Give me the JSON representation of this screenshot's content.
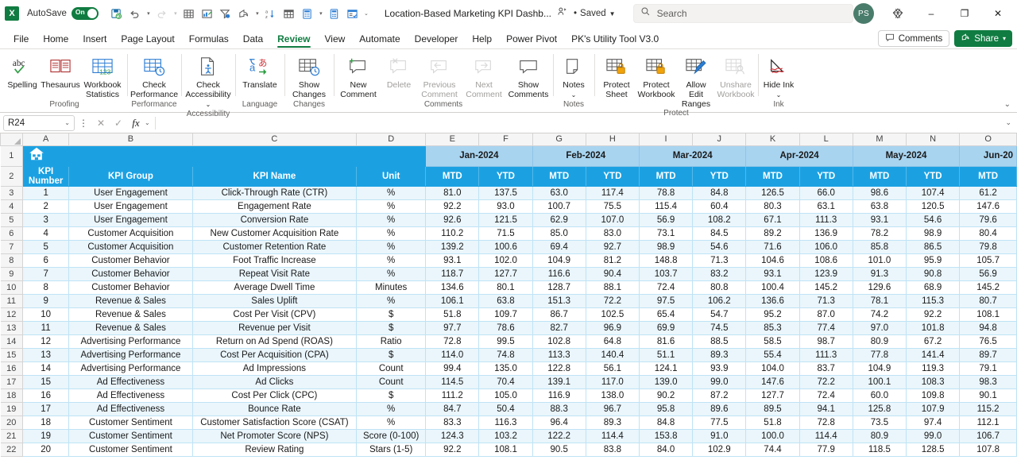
{
  "titlebar": {
    "app_logo": "X",
    "autosave_label": "AutoSave",
    "autosave_state": "On",
    "document_title": "Location-Based Marketing KPI Dashb...",
    "saved_status": "Saved",
    "saved_separator": "•",
    "search_placeholder": "Search",
    "avatar_initials": "PS",
    "minimize": "‒",
    "restore": "❐",
    "close": "✕"
  },
  "quick_access": [
    {
      "name": "save-icon",
      "glyph": "save"
    },
    {
      "name": "undo-icon",
      "glyph": "undo"
    },
    {
      "name": "redo-icon",
      "glyph": "redo"
    },
    {
      "name": "table-icon",
      "glyph": "table"
    },
    {
      "name": "insert-chart-icon",
      "glyph": "chart"
    },
    {
      "name": "filter-icon",
      "glyph": "filter"
    },
    {
      "name": "share-arrow-icon",
      "glyph": "share"
    },
    {
      "name": "sort-az-icon",
      "glyph": "sortaz"
    },
    {
      "name": "pivot-table-icon",
      "glyph": "pivot"
    },
    {
      "name": "calculator-icon",
      "glyph": "calc"
    },
    {
      "name": "calculator2-icon",
      "glyph": "calc2"
    },
    {
      "name": "form-icon",
      "glyph": "form"
    },
    {
      "name": "customize-qat-icon",
      "glyph": "chevron"
    }
  ],
  "ribbon_tabs": [
    {
      "label": "File",
      "active": false
    },
    {
      "label": "Home",
      "active": false
    },
    {
      "label": "Insert",
      "active": false
    },
    {
      "label": "Page Layout",
      "active": false
    },
    {
      "label": "Formulas",
      "active": false
    },
    {
      "label": "Data",
      "active": false
    },
    {
      "label": "Review",
      "active": true
    },
    {
      "label": "View",
      "active": false
    },
    {
      "label": "Automate",
      "active": false
    },
    {
      "label": "Developer",
      "active": false
    },
    {
      "label": "Help",
      "active": false
    },
    {
      "label": "Power Pivot",
      "active": false
    },
    {
      "label": "PK's Utility Tool V3.0",
      "active": false
    }
  ],
  "tabs_right": {
    "comments_label": "Comments",
    "share_label": "Share"
  },
  "ribbon_groups": [
    {
      "name": "Proofing",
      "buttons": [
        {
          "label": "Spelling",
          "icon": "spelling-icon",
          "disabled": false,
          "caret": false
        },
        {
          "label": "Thesaurus",
          "icon": "thesaurus-icon",
          "disabled": false,
          "caret": false
        },
        {
          "label": "Workbook Statistics",
          "icon": "workbook-statistics-icon",
          "disabled": false,
          "caret": false
        }
      ]
    },
    {
      "name": "Performance",
      "buttons": [
        {
          "label": "Check Performance",
          "icon": "check-performance-icon",
          "disabled": false,
          "caret": false
        }
      ]
    },
    {
      "name": "Accessibility",
      "buttons": [
        {
          "label": "Check Accessibility",
          "icon": "check-accessibility-icon",
          "disabled": false,
          "caret": true
        }
      ]
    },
    {
      "name": "Language",
      "buttons": [
        {
          "label": "Translate",
          "icon": "translate-icon",
          "disabled": false,
          "caret": false
        }
      ]
    },
    {
      "name": "Changes",
      "buttons": [
        {
          "label": "Show Changes",
          "icon": "show-changes-icon",
          "disabled": false,
          "caret": false
        }
      ]
    },
    {
      "name": "Comments",
      "buttons": [
        {
          "label": "New Comment",
          "icon": "new-comment-icon",
          "disabled": false,
          "caret": false
        },
        {
          "label": "Delete",
          "icon": "delete-comment-icon",
          "disabled": true,
          "caret": false
        },
        {
          "label": "Previous Comment",
          "icon": "previous-comment-icon",
          "disabled": true,
          "caret": false
        },
        {
          "label": "Next Comment",
          "icon": "next-comment-icon",
          "disabled": true,
          "caret": false
        },
        {
          "label": "Show Comments",
          "icon": "show-comments-icon",
          "disabled": false,
          "caret": false
        }
      ]
    },
    {
      "name": "Notes",
      "buttons": [
        {
          "label": "Notes",
          "icon": "notes-icon",
          "disabled": false,
          "caret": true
        }
      ]
    },
    {
      "name": "Protect",
      "buttons": [
        {
          "label": "Protect Sheet",
          "icon": "protect-sheet-icon",
          "disabled": false,
          "caret": false
        },
        {
          "label": "Protect Workbook",
          "icon": "protect-workbook-icon",
          "disabled": false,
          "caret": false
        },
        {
          "label": "Allow Edit Ranges",
          "icon": "allow-edit-ranges-icon",
          "disabled": false,
          "caret": false
        },
        {
          "label": "Unshare Workbook",
          "icon": "unshare-workbook-icon",
          "disabled": true,
          "caret": false
        }
      ]
    },
    {
      "name": "Ink",
      "buttons": [
        {
          "label": "Hide Ink",
          "icon": "hide-ink-icon",
          "disabled": false,
          "caret": true
        }
      ]
    }
  ],
  "formula_bar": {
    "name_box_value": "R24",
    "cancel_icon": "✕",
    "enter_icon": "✓",
    "fx_label": "fx",
    "formula_value": "",
    "formula_placeholder": ""
  },
  "grid": {
    "column_letters": [
      "A",
      "B",
      "C",
      "D",
      "E",
      "F",
      "G",
      "H",
      "I",
      "J",
      "K",
      "L",
      "M",
      "N",
      "O"
    ],
    "row_numbers": [
      1,
      2,
      3,
      4,
      5,
      6,
      7,
      8,
      9,
      10,
      11,
      12,
      13,
      14,
      15,
      16,
      17,
      18,
      19,
      20,
      21,
      22
    ],
    "home_icon": "home-icon",
    "month_headers": [
      "Jan-2024",
      "Feb-2024",
      "Mar-2024",
      "Apr-2024",
      "May-2024",
      "Jun-20"
    ],
    "sub_headers": [
      "MTD",
      "YTD"
    ],
    "left_headers": [
      "KPI Number",
      "KPI Group",
      "KPI Name",
      "Unit"
    ],
    "header_fill": "#1ba1e2",
    "month_fill": "#a8d4f0",
    "band_fill": "#eaf6fc",
    "rows": [
      {
        "num": "1",
        "group": "User Engagement",
        "kpi": "Click-Through Rate (CTR)",
        "unit": "%",
        "vals": [
          "81.0",
          "137.5",
          "63.0",
          "117.4",
          "78.8",
          "84.8",
          "126.5",
          "66.0",
          "98.6",
          "107.4",
          "61.2"
        ]
      },
      {
        "num": "2",
        "group": "User Engagement",
        "kpi": "Engagement Rate",
        "unit": "%",
        "vals": [
          "92.2",
          "93.0",
          "100.7",
          "75.5",
          "115.4",
          "60.4",
          "80.3",
          "63.1",
          "63.8",
          "120.5",
          "147.6"
        ]
      },
      {
        "num": "3",
        "group": "User Engagement",
        "kpi": "Conversion Rate",
        "unit": "%",
        "vals": [
          "92.6",
          "121.5",
          "62.9",
          "107.0",
          "56.9",
          "108.2",
          "67.1",
          "111.3",
          "93.1",
          "54.6",
          "79.6"
        ]
      },
      {
        "num": "4",
        "group": "Customer Acquisition",
        "kpi": "New Customer Acquisition Rate",
        "unit": "%",
        "vals": [
          "110.2",
          "71.5",
          "85.0",
          "83.0",
          "73.1",
          "84.5",
          "89.2",
          "136.9",
          "78.2",
          "98.9",
          "80.4"
        ]
      },
      {
        "num": "5",
        "group": "Customer Acquisition",
        "kpi": "Customer Retention Rate",
        "unit": "%",
        "vals": [
          "139.2",
          "100.6",
          "69.4",
          "92.7",
          "98.9",
          "54.6",
          "71.6",
          "106.0",
          "85.8",
          "86.5",
          "79.8"
        ]
      },
      {
        "num": "6",
        "group": "Customer Behavior",
        "kpi": "Foot Traffic Increase",
        "unit": "%",
        "vals": [
          "93.1",
          "102.0",
          "104.9",
          "81.2",
          "148.8",
          "71.3",
          "104.6",
          "108.6",
          "101.0",
          "95.9",
          "105.7"
        ]
      },
      {
        "num": "7",
        "group": "Customer Behavior",
        "kpi": "Repeat Visit Rate",
        "unit": "%",
        "vals": [
          "118.7",
          "127.7",
          "116.6",
          "90.4",
          "103.7",
          "83.2",
          "93.1",
          "123.9",
          "91.3",
          "90.8",
          "56.9"
        ]
      },
      {
        "num": "8",
        "group": "Customer Behavior",
        "kpi": "Average Dwell Time",
        "unit": "Minutes",
        "vals": [
          "134.6",
          "80.1",
          "128.7",
          "88.1",
          "72.4",
          "80.8",
          "100.4",
          "145.2",
          "129.6",
          "68.9",
          "145.2"
        ]
      },
      {
        "num": "9",
        "group": "Revenue & Sales",
        "kpi": "Sales Uplift",
        "unit": "%",
        "vals": [
          "106.1",
          "63.8",
          "151.3",
          "72.2",
          "97.5",
          "106.2",
          "136.6",
          "71.3",
          "78.1",
          "115.3",
          "80.7"
        ]
      },
      {
        "num": "10",
        "group": "Revenue & Sales",
        "kpi": "Cost Per Visit (CPV)",
        "unit": "$",
        "vals": [
          "51.8",
          "109.7",
          "86.7",
          "102.5",
          "65.4",
          "54.7",
          "95.2",
          "87.0",
          "74.2",
          "92.2",
          "108.1"
        ]
      },
      {
        "num": "11",
        "group": "Revenue & Sales",
        "kpi": "Revenue per Visit",
        "unit": "$",
        "vals": [
          "97.7",
          "78.6",
          "82.7",
          "96.9",
          "69.9",
          "74.5",
          "85.3",
          "77.4",
          "97.0",
          "101.8",
          "94.8"
        ]
      },
      {
        "num": "12",
        "group": "Advertising Performance",
        "kpi": "Return on Ad Spend (ROAS)",
        "unit": "Ratio",
        "vals": [
          "72.8",
          "99.5",
          "102.8",
          "64.8",
          "81.6",
          "88.5",
          "58.5",
          "98.7",
          "80.9",
          "67.2",
          "76.5"
        ]
      },
      {
        "num": "13",
        "group": "Advertising Performance",
        "kpi": "Cost Per Acquisition (CPA)",
        "unit": "$",
        "vals": [
          "114.0",
          "74.8",
          "113.3",
          "140.4",
          "51.1",
          "89.3",
          "55.4",
          "111.3",
          "77.8",
          "141.4",
          "89.7"
        ]
      },
      {
        "num": "14",
        "group": "Advertising Performance",
        "kpi": "Ad Impressions",
        "unit": "Count",
        "vals": [
          "99.4",
          "135.0",
          "122.8",
          "56.1",
          "124.1",
          "93.9",
          "104.0",
          "83.7",
          "104.9",
          "119.3",
          "79.1"
        ]
      },
      {
        "num": "15",
        "group": "Ad Effectiveness",
        "kpi": "Ad Clicks",
        "unit": "Count",
        "vals": [
          "114.5",
          "70.4",
          "139.1",
          "117.0",
          "139.0",
          "99.0",
          "147.6",
          "72.2",
          "100.1",
          "108.3",
          "98.3"
        ]
      },
      {
        "num": "16",
        "group": "Ad Effectiveness",
        "kpi": "Cost Per Click (CPC)",
        "unit": "$",
        "vals": [
          "111.2",
          "105.0",
          "116.9",
          "138.0",
          "90.2",
          "87.2",
          "127.7",
          "72.4",
          "60.0",
          "109.8",
          "90.1"
        ]
      },
      {
        "num": "17",
        "group": "Ad Effectiveness",
        "kpi": "Bounce Rate",
        "unit": "%",
        "vals": [
          "84.7",
          "50.4",
          "88.3",
          "96.7",
          "95.8",
          "89.6",
          "89.5",
          "94.1",
          "125.8",
          "107.9",
          "115.2"
        ]
      },
      {
        "num": "18",
        "group": "Customer Sentiment",
        "kpi": "Customer Satisfaction Score (CSAT)",
        "unit": "%",
        "vals": [
          "83.3",
          "116.3",
          "96.4",
          "89.3",
          "84.8",
          "77.5",
          "51.8",
          "72.8",
          "73.5",
          "97.4",
          "112.1"
        ]
      },
      {
        "num": "19",
        "group": "Customer Sentiment",
        "kpi": "Net Promoter Score (NPS)",
        "unit": "Score (0-100)",
        "vals": [
          "124.3",
          "103.2",
          "122.2",
          "114.4",
          "153.8",
          "91.0",
          "100.0",
          "114.4",
          "80.9",
          "99.0",
          "106.7"
        ]
      },
      {
        "num": "20",
        "group": "Customer Sentiment",
        "kpi": "Review Rating",
        "unit": "Stars (1-5)",
        "vals": [
          "92.2",
          "108.1",
          "90.5",
          "83.8",
          "84.0",
          "102.9",
          "74.4",
          "77.9",
          "118.5",
          "128.5",
          "107.8"
        ]
      }
    ]
  }
}
